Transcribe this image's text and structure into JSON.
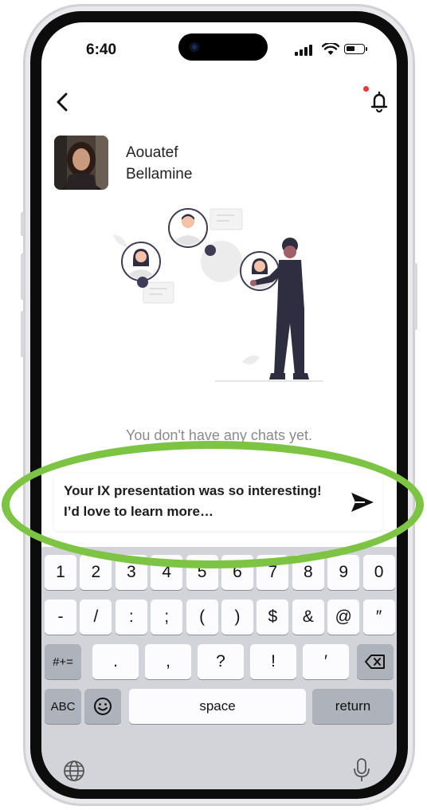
{
  "status_bar": {
    "time": "6:40",
    "battery_level": 0.5
  },
  "header": {
    "back_icon": "chevron-left-icon",
    "notification_icon": "bell-icon",
    "notification_dot_color": "#e53935"
  },
  "contact": {
    "name": "Aouatef Bellamine"
  },
  "empty_state": {
    "text": "You don't have any chats yet."
  },
  "composer": {
    "message": "Your IX presentation was so interesting! I’d love to learn more…",
    "send_icon": "send-icon"
  },
  "keyboard": {
    "row1": [
      "1",
      "2",
      "3",
      "4",
      "5",
      "6",
      "7",
      "8",
      "9",
      "0"
    ],
    "row2": [
      "-",
      "/",
      ":",
      ";",
      "(",
      ")",
      "$",
      "&",
      "@",
      "″"
    ],
    "row3": [
      ".",
      ",",
      "?",
      "!",
      "′"
    ],
    "symbols_key": "#+=",
    "abc_key": "ABC",
    "space_key": "space",
    "return_key": "return",
    "emoji_icon": "emoji-icon",
    "globe_icon": "globe-icon",
    "mic_icon": "microphone-icon",
    "delete_icon": "backspace-icon"
  },
  "highlight_color": "#7ec444"
}
